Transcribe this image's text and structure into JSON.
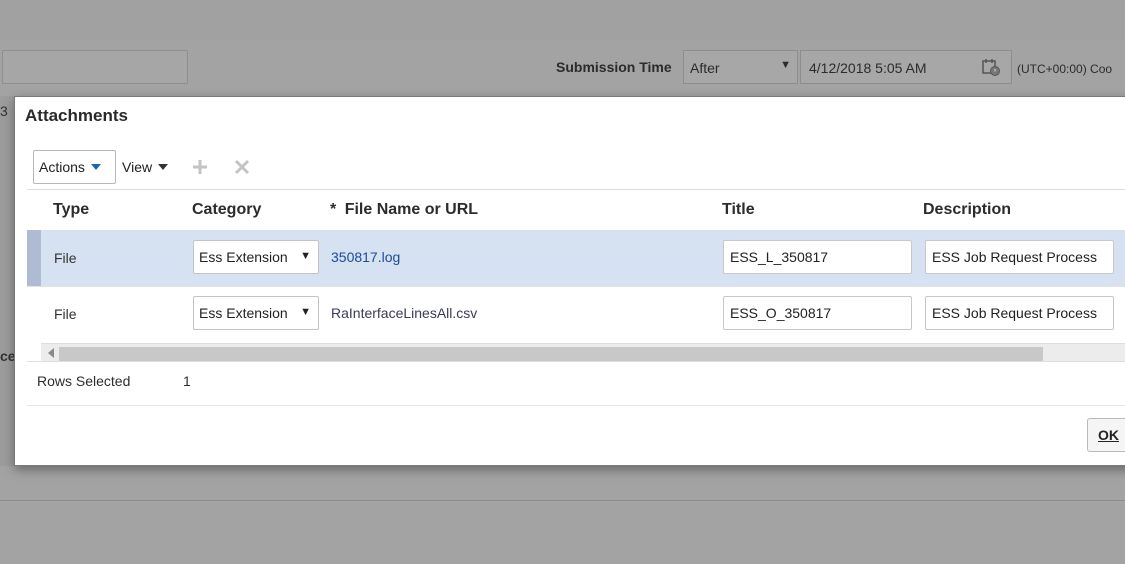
{
  "background": {
    "submission_time_label": "Submission Time",
    "submission_select_value": "After",
    "submission_date_value": "4/12/2018 5:05 AM",
    "timezone_text": "(UTC+00:00) Coo",
    "left_char": "3",
    "left_text": "ce"
  },
  "dialog": {
    "title": "Attachments",
    "toolbar": {
      "actions_label": "Actions",
      "view_label": "View",
      "add_icon": "plus-icon",
      "delete_icon": "x-icon"
    },
    "table": {
      "columns": {
        "type": "Type",
        "category": "Category",
        "required_mark": "*",
        "file_name": "File Name or URL",
        "title": "Title",
        "description": "Description"
      },
      "rows": [
        {
          "type": "File",
          "category": "Ess Extension",
          "file_name": "350817.log",
          "title": "ESS_L_350817",
          "description": "ESS Job Request Process",
          "selected": true
        },
        {
          "type": "File",
          "category": "Ess Extension",
          "file_name": "RaInterfaceLinesAll.csv",
          "title": "ESS_O_350817",
          "description": "ESS Job Request Process",
          "selected": false
        }
      ]
    },
    "footer": {
      "rows_selected_label": "Rows Selected",
      "rows_selected_value": "1"
    },
    "ok_label": "OK"
  },
  "colors": {
    "selected_row": "#d6e1f1",
    "link": "#1a4c9a",
    "actions_arrow": "#1e64b4"
  }
}
